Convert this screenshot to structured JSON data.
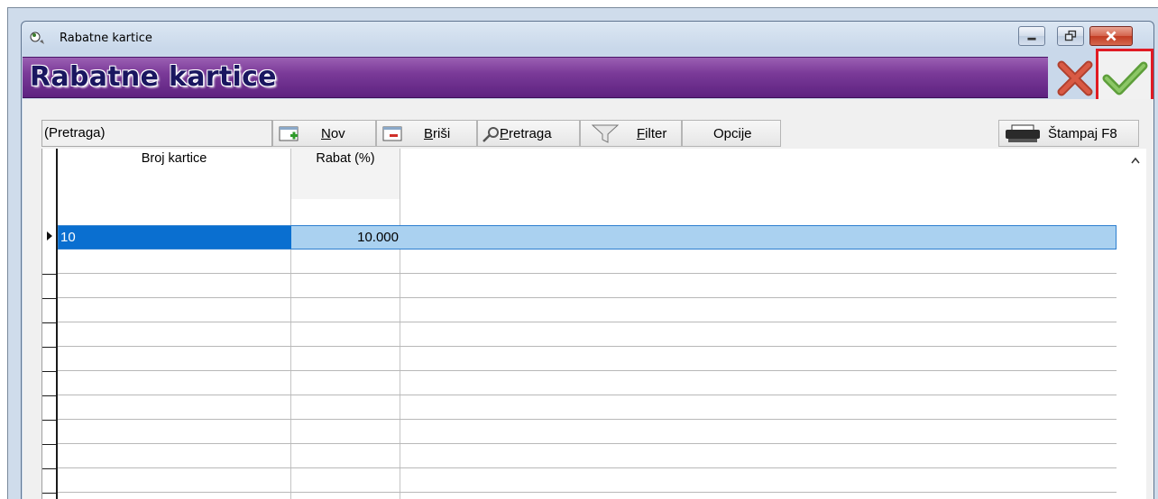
{
  "window": {
    "title": "Rabatne kartice",
    "controls": {
      "minimize": "minimize",
      "maximize": "restore",
      "close": "close"
    }
  },
  "header": {
    "title": "Rabatne kartice"
  },
  "actions": {
    "cancel_icon": "red-x-icon",
    "ok_icon": "green-check-icon"
  },
  "toolbar": {
    "search_value": "(Pretraga)",
    "new_label_u": "N",
    "new_label_rest": "ov",
    "delete_label_u": "B",
    "delete_label_rest": "riši",
    "search_label_u": "P",
    "search_label_rest": "retraga",
    "filter_label_u": "F",
    "filter_label_rest": "ilter",
    "options_label": "Opcije",
    "print_label": "Štampaj F8"
  },
  "grid": {
    "columns": [
      "Broj kartice",
      "Rabat (%)"
    ],
    "rows": [
      {
        "broj": "10",
        "rabat": "10.000"
      }
    ]
  },
  "colors": {
    "header_band": "#7a3a98",
    "header_text": "#1a1660",
    "selection": "#0a6fd0",
    "selection_row": "#aad1f0",
    "ok_highlight": "#e01b24"
  }
}
